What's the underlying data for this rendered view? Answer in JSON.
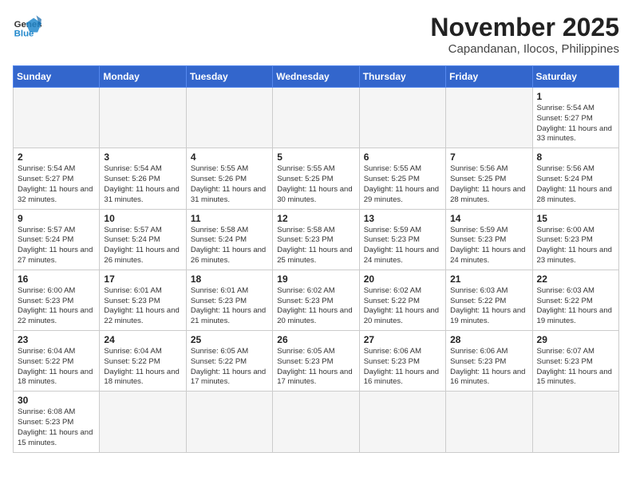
{
  "header": {
    "logo_general": "General",
    "logo_blue": "Blue",
    "month_title": "November 2025",
    "subtitle": "Capandanan, Ilocos, Philippines"
  },
  "weekdays": [
    "Sunday",
    "Monday",
    "Tuesday",
    "Wednesday",
    "Thursday",
    "Friday",
    "Saturday"
  ],
  "weeks": [
    [
      {
        "day": null
      },
      {
        "day": null
      },
      {
        "day": null
      },
      {
        "day": null
      },
      {
        "day": null
      },
      {
        "day": null
      },
      {
        "day": 1,
        "sunrise": "5:54 AM",
        "sunset": "5:27 PM",
        "daylight": "11 hours and 33 minutes."
      }
    ],
    [
      {
        "day": 2,
        "sunrise": "5:54 AM",
        "sunset": "5:27 PM",
        "daylight": "11 hours and 32 minutes."
      },
      {
        "day": 3,
        "sunrise": "5:54 AM",
        "sunset": "5:26 PM",
        "daylight": "11 hours and 31 minutes."
      },
      {
        "day": 4,
        "sunrise": "5:55 AM",
        "sunset": "5:26 PM",
        "daylight": "11 hours and 31 minutes."
      },
      {
        "day": 5,
        "sunrise": "5:55 AM",
        "sunset": "5:25 PM",
        "daylight": "11 hours and 30 minutes."
      },
      {
        "day": 6,
        "sunrise": "5:55 AM",
        "sunset": "5:25 PM",
        "daylight": "11 hours and 29 minutes."
      },
      {
        "day": 7,
        "sunrise": "5:56 AM",
        "sunset": "5:25 PM",
        "daylight": "11 hours and 28 minutes."
      },
      {
        "day": 8,
        "sunrise": "5:56 AM",
        "sunset": "5:24 PM",
        "daylight": "11 hours and 28 minutes."
      }
    ],
    [
      {
        "day": 9,
        "sunrise": "5:57 AM",
        "sunset": "5:24 PM",
        "daylight": "11 hours and 27 minutes."
      },
      {
        "day": 10,
        "sunrise": "5:57 AM",
        "sunset": "5:24 PM",
        "daylight": "11 hours and 26 minutes."
      },
      {
        "day": 11,
        "sunrise": "5:58 AM",
        "sunset": "5:24 PM",
        "daylight": "11 hours and 26 minutes."
      },
      {
        "day": 12,
        "sunrise": "5:58 AM",
        "sunset": "5:23 PM",
        "daylight": "11 hours and 25 minutes."
      },
      {
        "day": 13,
        "sunrise": "5:59 AM",
        "sunset": "5:23 PM",
        "daylight": "11 hours and 24 minutes."
      },
      {
        "day": 14,
        "sunrise": "5:59 AM",
        "sunset": "5:23 PM",
        "daylight": "11 hours and 24 minutes."
      },
      {
        "day": 15,
        "sunrise": "6:00 AM",
        "sunset": "5:23 PM",
        "daylight": "11 hours and 23 minutes."
      }
    ],
    [
      {
        "day": 16,
        "sunrise": "6:00 AM",
        "sunset": "5:23 PM",
        "daylight": "11 hours and 22 minutes."
      },
      {
        "day": 17,
        "sunrise": "6:01 AM",
        "sunset": "5:23 PM",
        "daylight": "11 hours and 22 minutes."
      },
      {
        "day": 18,
        "sunrise": "6:01 AM",
        "sunset": "5:23 PM",
        "daylight": "11 hours and 21 minutes."
      },
      {
        "day": 19,
        "sunrise": "6:02 AM",
        "sunset": "5:23 PM",
        "daylight": "11 hours and 20 minutes."
      },
      {
        "day": 20,
        "sunrise": "6:02 AM",
        "sunset": "5:22 PM",
        "daylight": "11 hours and 20 minutes."
      },
      {
        "day": 21,
        "sunrise": "6:03 AM",
        "sunset": "5:22 PM",
        "daylight": "11 hours and 19 minutes."
      },
      {
        "day": 22,
        "sunrise": "6:03 AM",
        "sunset": "5:22 PM",
        "daylight": "11 hours and 19 minutes."
      }
    ],
    [
      {
        "day": 23,
        "sunrise": "6:04 AM",
        "sunset": "5:22 PM",
        "daylight": "11 hours and 18 minutes."
      },
      {
        "day": 24,
        "sunrise": "6:04 AM",
        "sunset": "5:22 PM",
        "daylight": "11 hours and 18 minutes."
      },
      {
        "day": 25,
        "sunrise": "6:05 AM",
        "sunset": "5:22 PM",
        "daylight": "11 hours and 17 minutes."
      },
      {
        "day": 26,
        "sunrise": "6:05 AM",
        "sunset": "5:23 PM",
        "daylight": "11 hours and 17 minutes."
      },
      {
        "day": 27,
        "sunrise": "6:06 AM",
        "sunset": "5:23 PM",
        "daylight": "11 hours and 16 minutes."
      },
      {
        "day": 28,
        "sunrise": "6:06 AM",
        "sunset": "5:23 PM",
        "daylight": "11 hours and 16 minutes."
      },
      {
        "day": 29,
        "sunrise": "6:07 AM",
        "sunset": "5:23 PM",
        "daylight": "11 hours and 15 minutes."
      }
    ],
    [
      {
        "day": 30,
        "sunrise": "6:08 AM",
        "sunset": "5:23 PM",
        "daylight": "11 hours and 15 minutes."
      },
      {
        "day": null
      },
      {
        "day": null
      },
      {
        "day": null
      },
      {
        "day": null
      },
      {
        "day": null
      },
      {
        "day": null
      }
    ]
  ]
}
